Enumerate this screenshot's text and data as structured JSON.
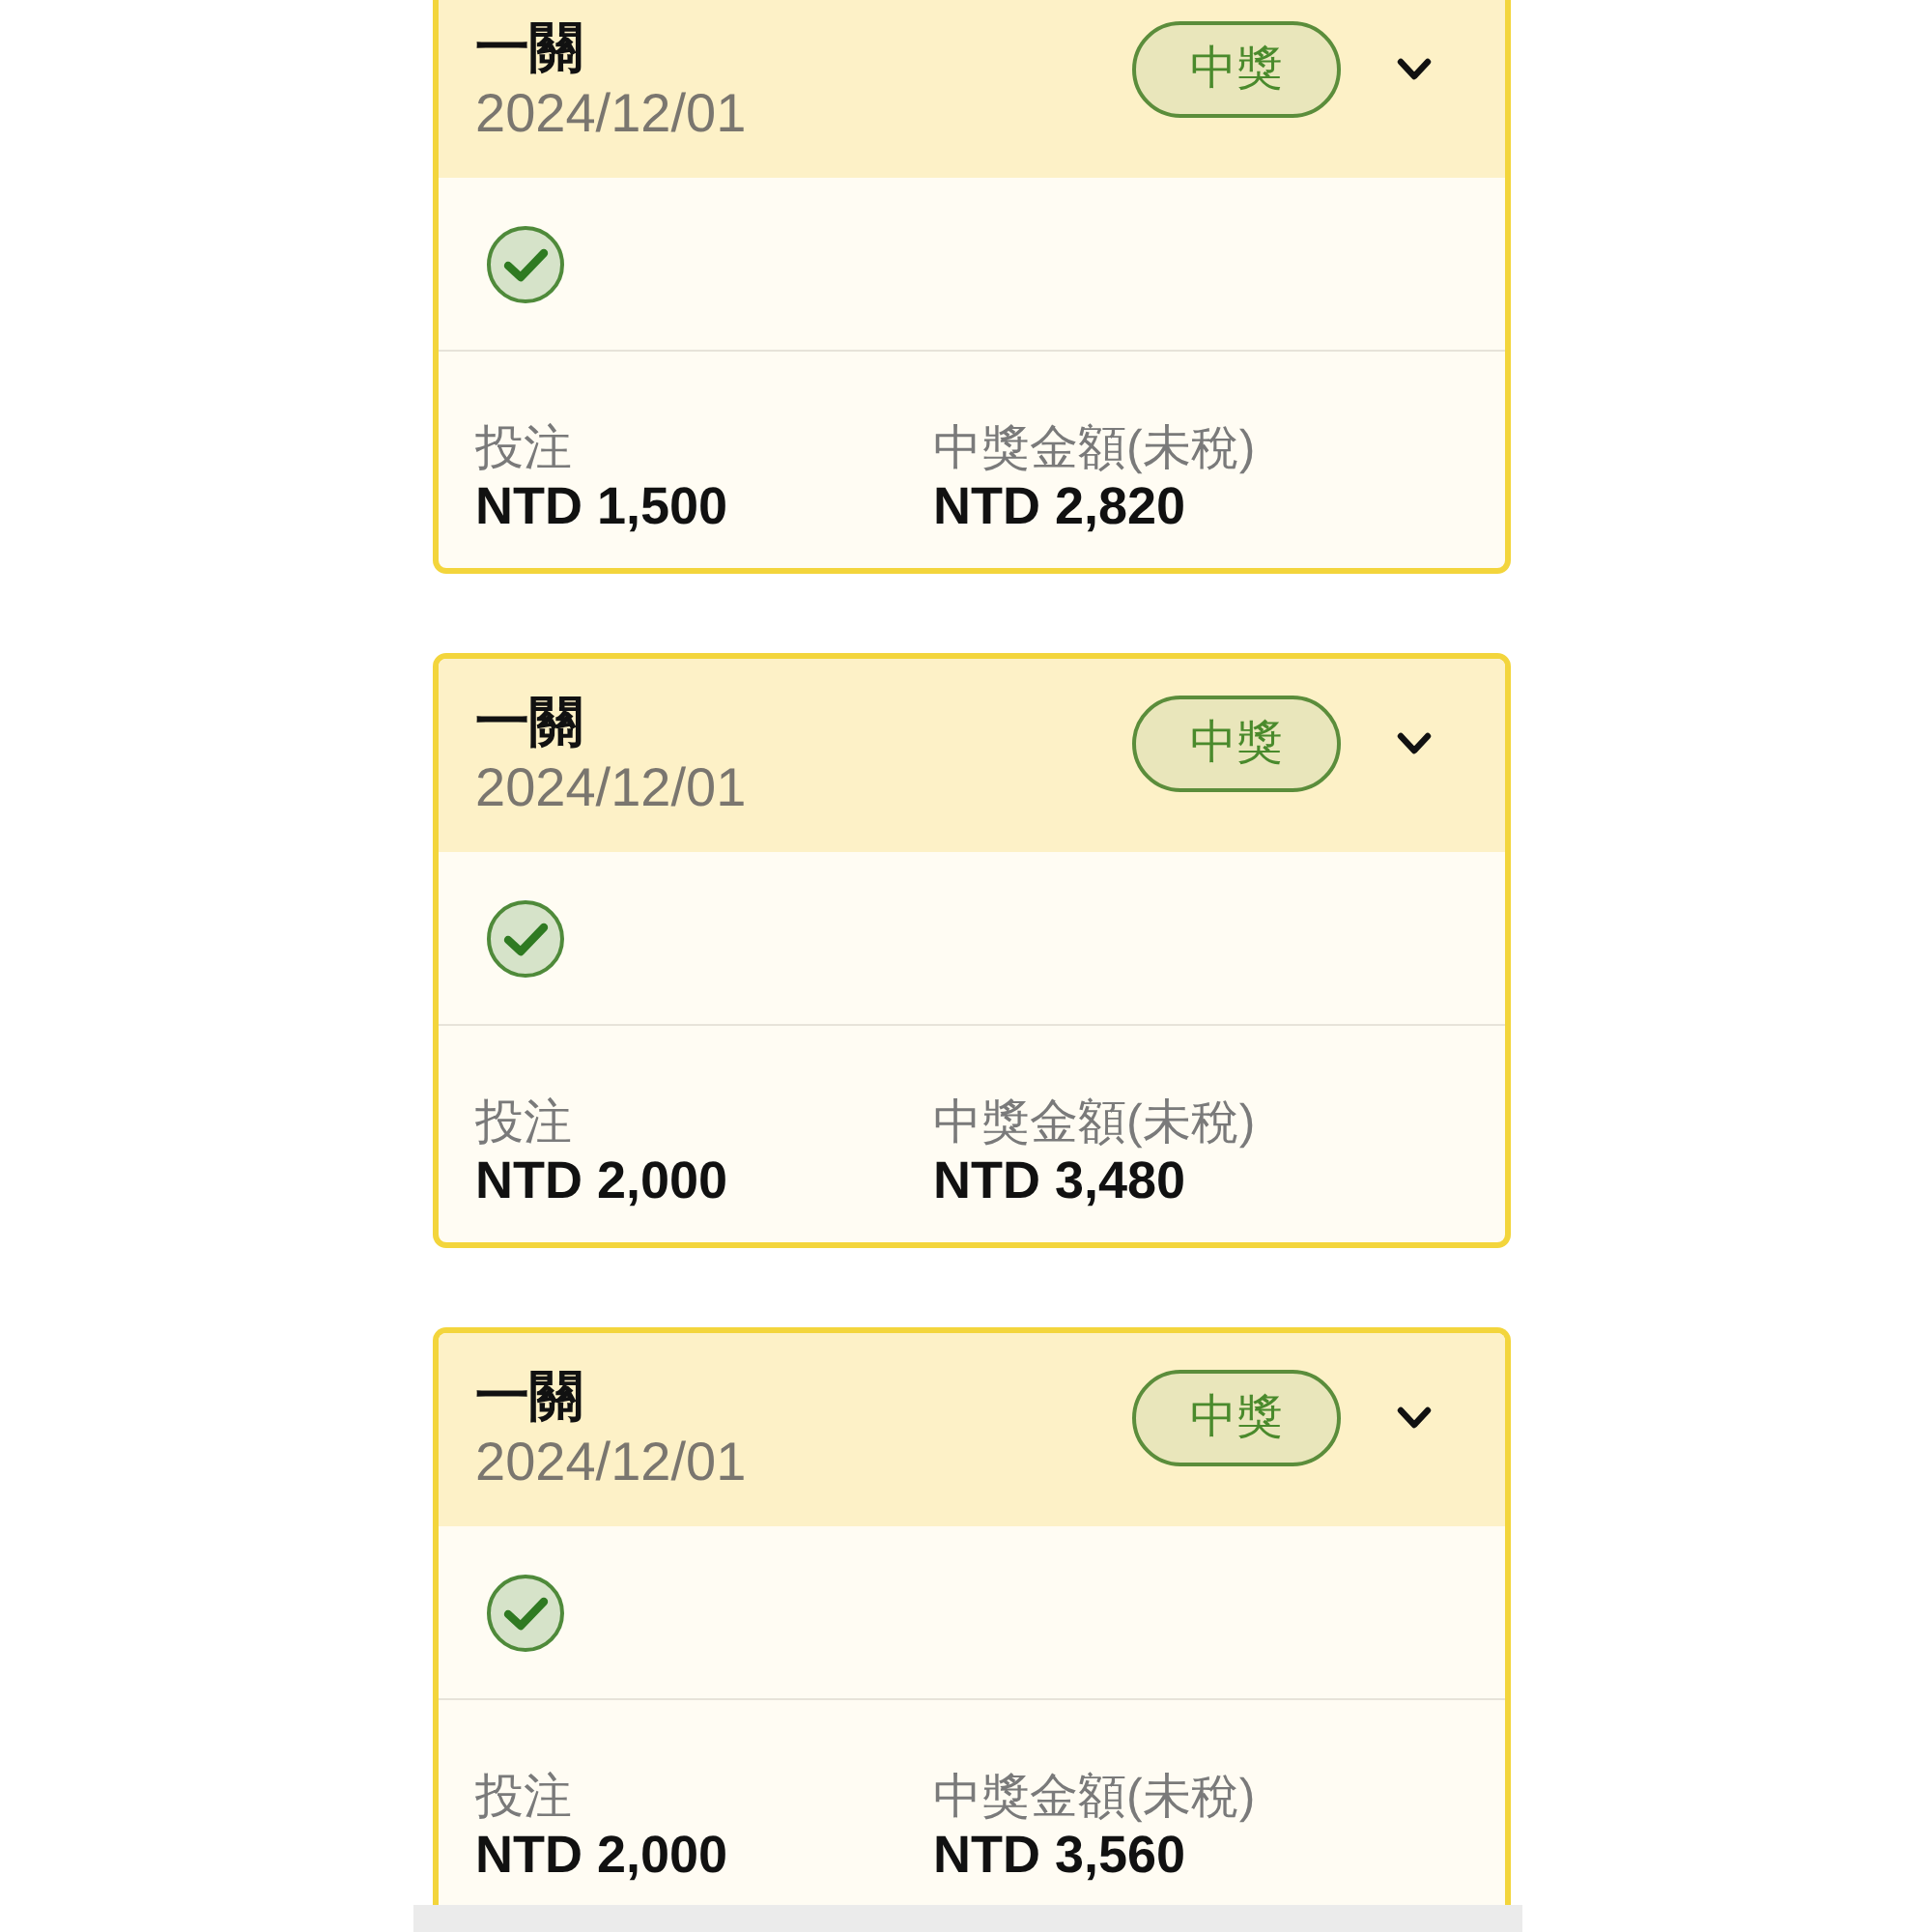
{
  "cards": [
    {
      "title": "一關",
      "date": "2024/12/01",
      "badge": "中獎",
      "stats": [
        {
          "label": "投注",
          "value": "NTD 1,500"
        },
        {
          "label": "中獎金額(未稅)",
          "value": "NTD 2,820"
        }
      ]
    },
    {
      "title": "一關",
      "date": "2024/12/01",
      "badge": "中獎",
      "stats": [
        {
          "label": "投注",
          "value": "NTD 2,000"
        },
        {
          "label": "中獎金額(未稅)",
          "value": "NTD 3,480"
        }
      ]
    },
    {
      "title": "一關",
      "date": "2024/12/01",
      "badge": "中獎",
      "stats": [
        {
          "label": "投注",
          "value": "NTD 2,000"
        },
        {
          "label": "中獎金額(未稅)",
          "value": "NTD 3,560"
        }
      ]
    }
  ]
}
